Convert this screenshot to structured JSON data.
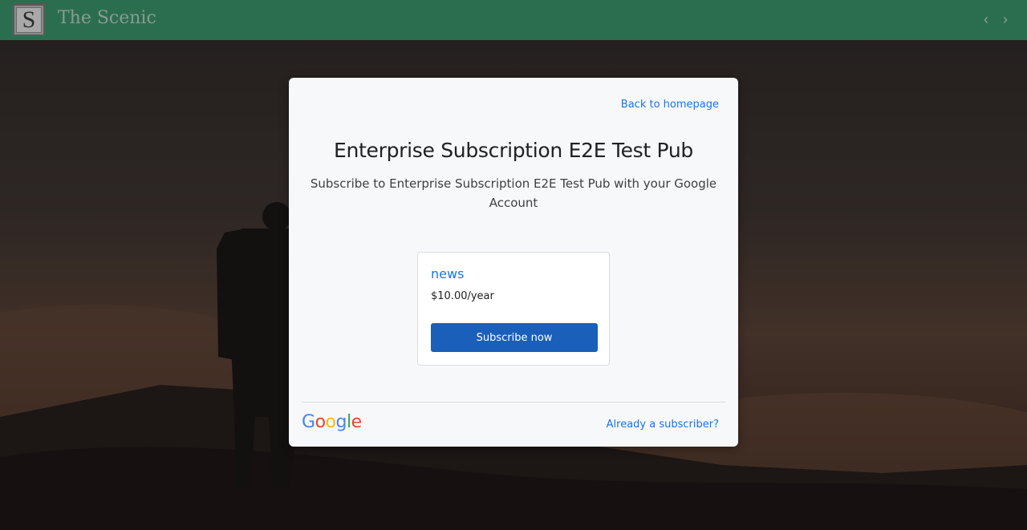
{
  "header": {
    "logo_letter": "S",
    "site_title": "The Scenic",
    "prev_label": "‹",
    "next_label": "›"
  },
  "modal": {
    "back_link": "Back to homepage",
    "title": "Enterprise Subscription E2E Test Pub",
    "subtitle": "Subscribe to Enterprise Subscription E2E Test Pub with your Google Account",
    "plan": {
      "name": "news",
      "price": "$10.00/year",
      "button_label": "Subscribe now"
    },
    "google_logo": [
      "G",
      "o",
      "o",
      "g",
      "l",
      "e"
    ],
    "google_logo_colors": [
      "#4285F4",
      "#EA4335",
      "#FBBC05",
      "#4285F4",
      "#34A853",
      "#EA4335"
    ],
    "subscriber_link": "Already a subscriber?"
  },
  "colors": {
    "header_bg": "#2b6e4f",
    "link": "#1a73e8",
    "button": "#1a5fb9"
  }
}
